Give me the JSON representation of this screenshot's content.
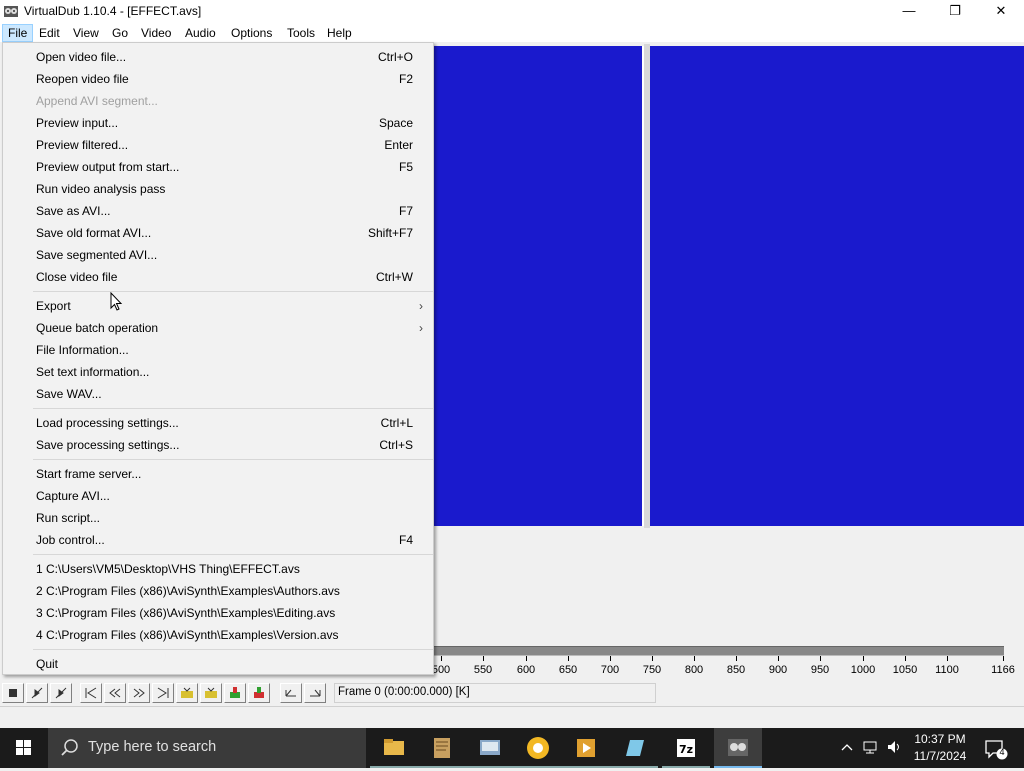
{
  "window": {
    "title": "VirtualDub 1.10.4 - [EFFECT.avs]",
    "minimize": "—",
    "maximize": "❐",
    "close": "✕"
  },
  "menubar": [
    "File",
    "Edit",
    "View",
    "Go",
    "Video",
    "Audio",
    "Options",
    "Tools",
    "Help"
  ],
  "file_menu": {
    "items": [
      {
        "label": "Open video file...",
        "accel": "Ctrl+O"
      },
      {
        "label": "Reopen video file",
        "accel": "F2"
      },
      {
        "label": "Append AVI segment...",
        "accel": "",
        "disabled": true
      },
      {
        "label": "Preview input...",
        "accel": "Space"
      },
      {
        "label": "Preview filtered...",
        "accel": "Enter"
      },
      {
        "label": "Preview output from start...",
        "accel": "F5"
      },
      {
        "label": "Run video analysis pass",
        "accel": ""
      },
      {
        "label": "Save as AVI...",
        "accel": "F7"
      },
      {
        "label": "Save old format AVI...",
        "accel": "Shift+F7"
      },
      {
        "label": "Save segmented AVI...",
        "accel": ""
      },
      {
        "label": "Close video file",
        "accel": "Ctrl+W"
      },
      {
        "label": "Export",
        "accel": "",
        "submenu": true
      },
      {
        "label": "Queue batch operation",
        "accel": "",
        "submenu": true
      },
      {
        "label": "File Information...",
        "accel": ""
      },
      {
        "label": "Set text information...",
        "accel": ""
      },
      {
        "label": "Save WAV...",
        "accel": ""
      },
      {
        "label": "Load processing settings...",
        "accel": "Ctrl+L"
      },
      {
        "label": "Save processing settings...",
        "accel": "Ctrl+S"
      },
      {
        "label": "Start frame server...",
        "accel": ""
      },
      {
        "label": "Capture AVI...",
        "accel": ""
      },
      {
        "label": "Run script...",
        "accel": ""
      },
      {
        "label": "Job control...",
        "accel": "F4"
      },
      {
        "label": "1 C:\\Users\\VM5\\Desktop\\VHS Thing\\EFFECT.avs",
        "accel": ""
      },
      {
        "label": "2 C:\\Program Files (x86)\\AviSynth\\Examples\\Authors.avs",
        "accel": ""
      },
      {
        "label": "3 C:\\Program Files (x86)\\AviSynth\\Examples\\Editing.avs",
        "accel": ""
      },
      {
        "label": "4 C:\\Program Files (x86)\\AviSynth\\Examples\\Version.avs",
        "accel": ""
      },
      {
        "label": "Quit",
        "accel": ""
      }
    ]
  },
  "timeline": {
    "tick_labels": [
      "500",
      "550",
      "600",
      "650",
      "700",
      "750",
      "800",
      "850",
      "900",
      "950",
      "1000",
      "1050",
      "1100",
      "1166"
    ]
  },
  "frame_status": "Frame 0 (0:00:00.000) [K]",
  "taskbar": {
    "search_placeholder": "Type here to search",
    "time": "10:37 PM",
    "date": "11/7/2024",
    "notification_count": "4",
    "colors": {
      "bg": "#1b1b1b",
      "accent": "#76b9ed"
    }
  },
  "colors": {
    "video_pane": "#1a1acd",
    "menu_highlight": "#cce8ff"
  }
}
